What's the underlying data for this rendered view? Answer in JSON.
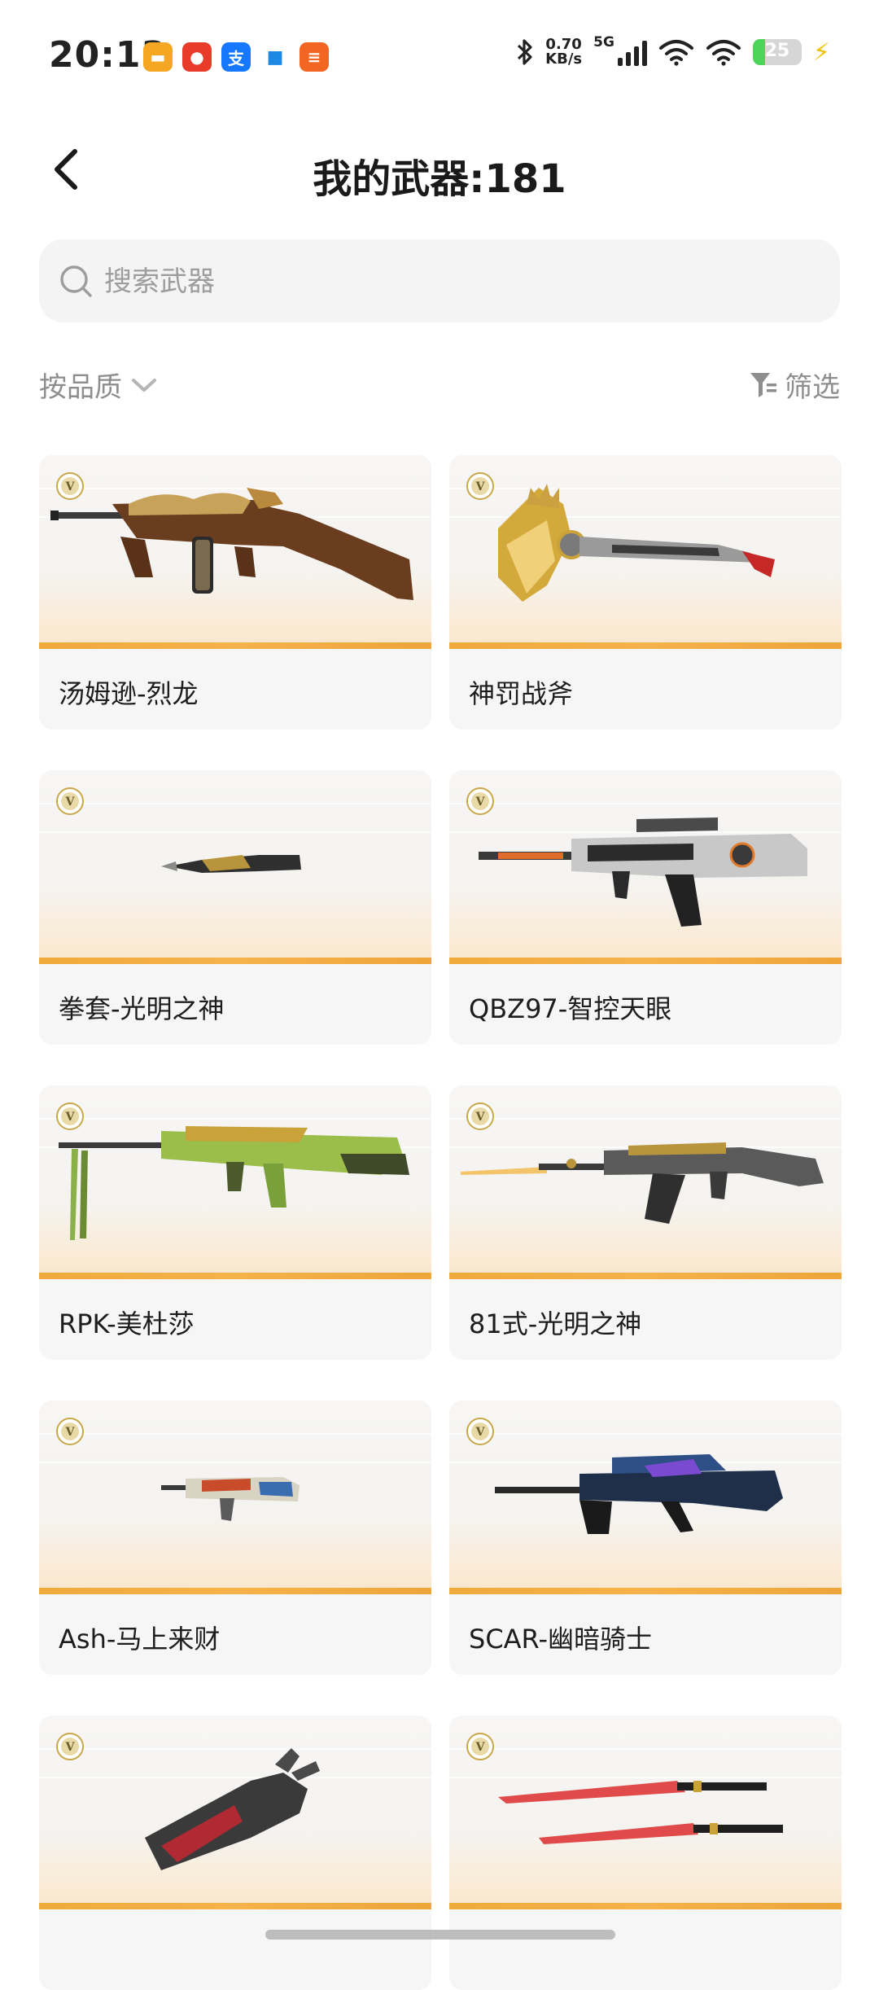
{
  "status_bar": {
    "time": "20:13",
    "net_speed_value": "0.70",
    "net_speed_unit": "KB/s",
    "network_type": "5G",
    "battery": "25"
  },
  "header": {
    "title": "我的武器:181"
  },
  "search": {
    "placeholder": "搜索武器",
    "value": ""
  },
  "sort": {
    "label": "按品质"
  },
  "filter": {
    "label": "筛选"
  },
  "weapons": [
    {
      "name": "汤姆逊-烈龙",
      "tier": "V"
    },
    {
      "name": "神罚战斧",
      "tier": "V"
    },
    {
      "name": "拳套-光明之神",
      "tier": "V"
    },
    {
      "name": "QBZ97-智控天眼",
      "tier": "V"
    },
    {
      "name": "RPK-美杜莎",
      "tier": "V"
    },
    {
      "name": "81式-光明之神",
      "tier": "V"
    },
    {
      "name": "Ash-马上来财",
      "tier": "V"
    },
    {
      "name": "SCAR-幽暗骑士",
      "tier": "V"
    },
    {
      "name": "",
      "tier": "V"
    },
    {
      "name": "",
      "tier": "V"
    }
  ],
  "colors": {
    "accent": "#f0a93b",
    "card_bg": "#f6f6f6",
    "search_bg": "#f4f4f4",
    "muted_text": "#8e8e8e"
  },
  "icons": {
    "back": "chevron-left-icon",
    "search": "search-icon",
    "sort": "chevron-down-icon",
    "filter": "filter-funnel-icon",
    "tier": "v-medal-icon"
  }
}
